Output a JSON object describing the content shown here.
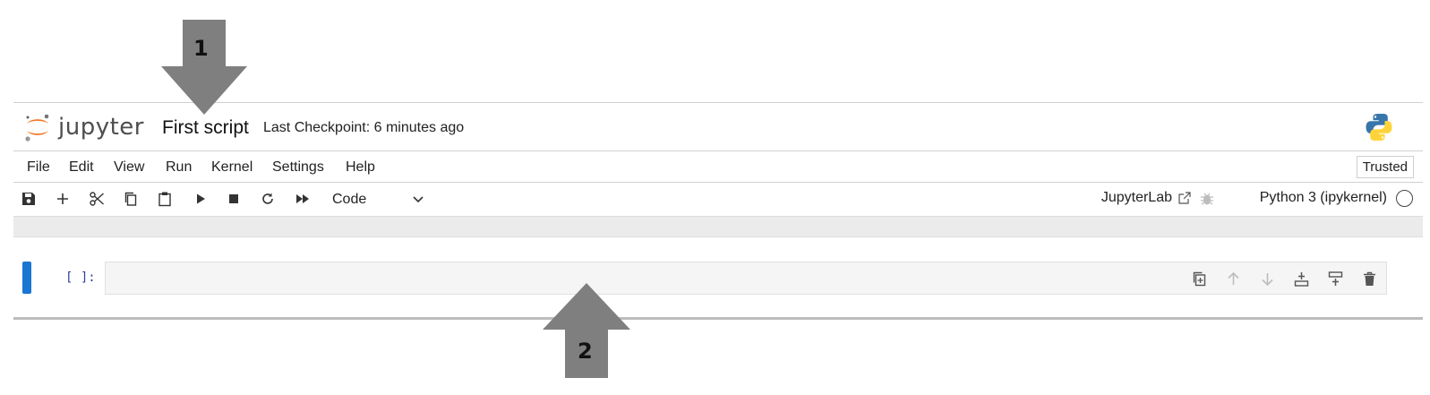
{
  "header": {
    "logo_text": "jupyter",
    "notebook_title": "First script",
    "checkpoint": "Last Checkpoint: 6 minutes ago"
  },
  "menubar": {
    "items": [
      "File",
      "Edit",
      "View",
      "Run",
      "Kernel",
      "Settings",
      "Help"
    ],
    "trusted": "Trusted"
  },
  "toolbar": {
    "icons": [
      "save-icon",
      "add-cell-icon",
      "cut-icon",
      "copy-icon",
      "paste-icon",
      "run-icon",
      "stop-icon",
      "restart-icon",
      "run-all-icon"
    ],
    "cell_type": "Code",
    "jupyterlab_label": "JupyterLab",
    "kernel_name": "Python 3 (ipykernel)"
  },
  "cell": {
    "prompt": "[ ]:",
    "tools": [
      "duplicate-icon",
      "move-up-icon",
      "move-down-icon",
      "insert-above-icon",
      "insert-below-icon",
      "delete-icon"
    ]
  },
  "annotations": {
    "arrow1": "1",
    "arrow2": "2",
    "arrow_color": "#7f7f7f"
  },
  "colors": {
    "accent": "#1976d2",
    "jupyter_orange": "#f37726",
    "prompt": "#303f9f"
  }
}
